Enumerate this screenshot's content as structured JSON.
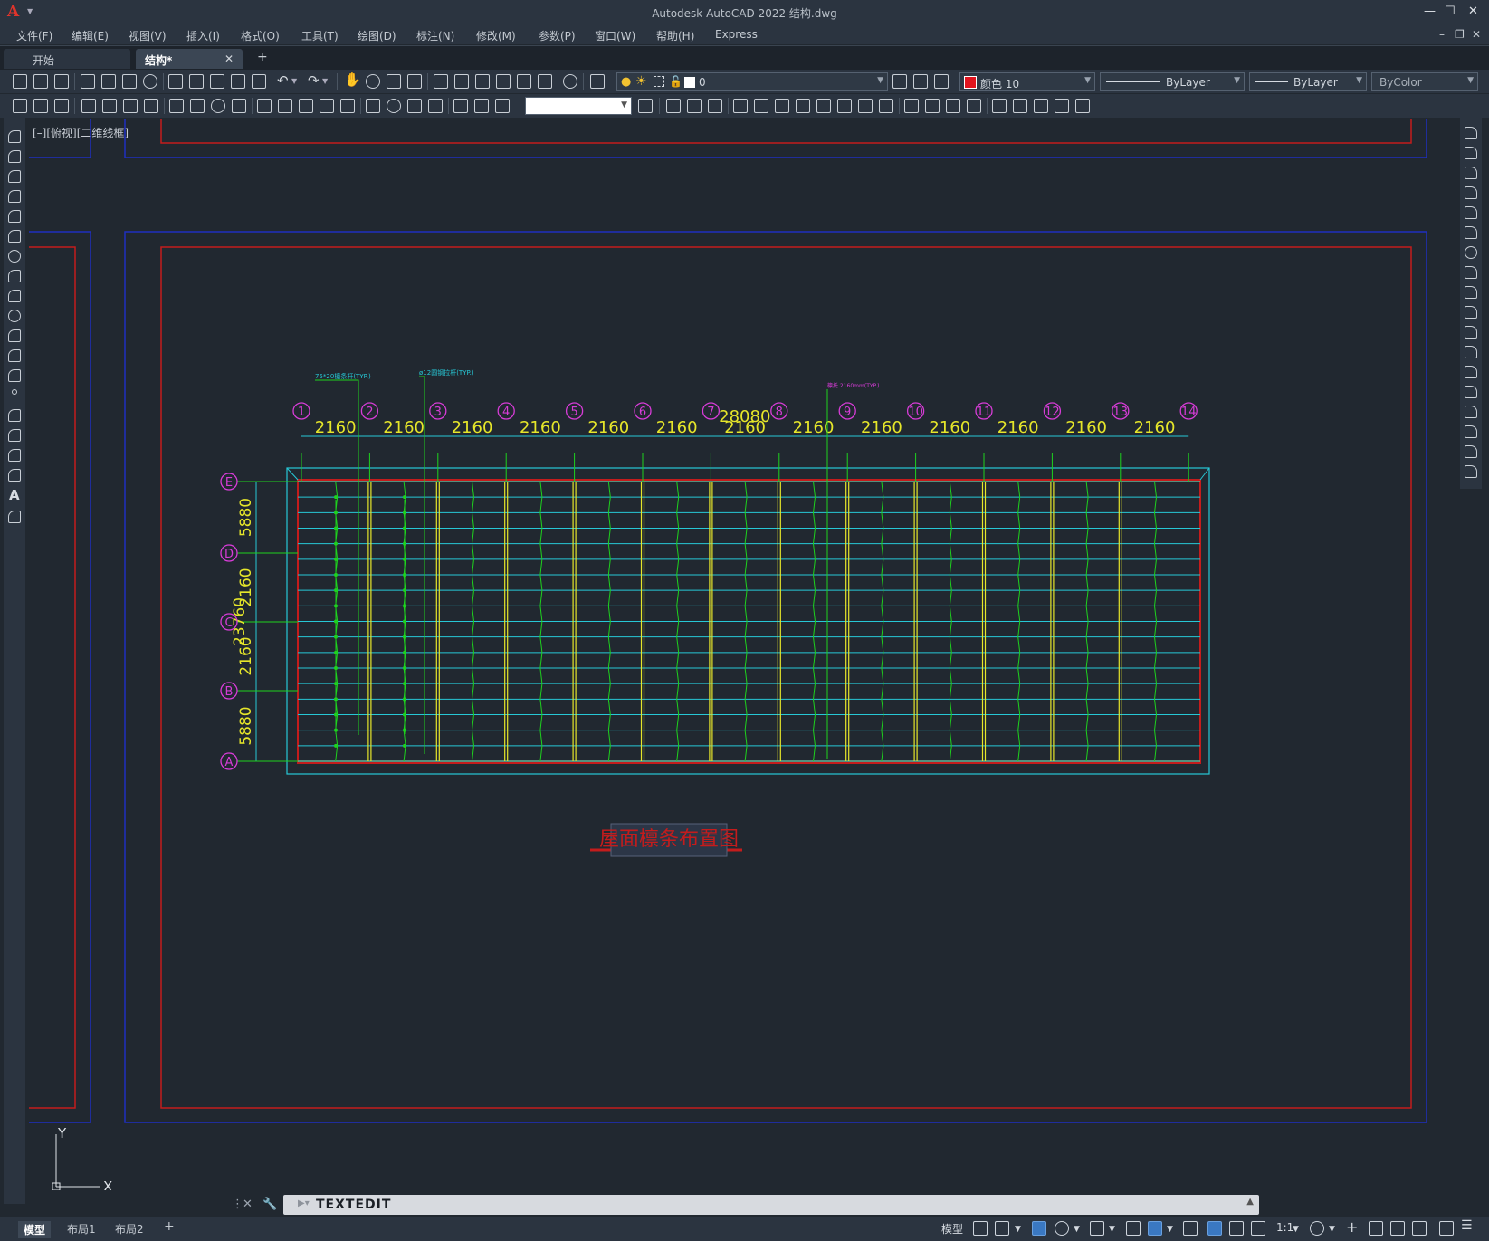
{
  "app": {
    "title": "Autodesk AutoCAD 2022    结构.dwg",
    "logo": "A",
    "window_controls": [
      "—",
      "☐",
      "✕"
    ],
    "doc_controls": [
      "–",
      "❐",
      "✕"
    ]
  },
  "menu": [
    "文件(F)",
    "编辑(E)",
    "视图(V)",
    "插入(I)",
    "格式(O)",
    "工具(T)",
    "绘图(D)",
    "标注(N)",
    "修改(M)",
    "参数(P)",
    "窗口(W)",
    "帮助(H)",
    "Express"
  ],
  "tabs": {
    "items": [
      {
        "label": "开始",
        "active": false
      },
      {
        "label": "结构*",
        "active": true
      }
    ],
    "close": "✕",
    "add": "+"
  },
  "properties": {
    "layer": "0",
    "color": "颜色 10",
    "color_swatch": "#e0141e",
    "linetype": "ByLayer",
    "lineweight": "ByLayer",
    "plotstyle": "ByColor",
    "style_combo": ""
  },
  "viewport": {
    "label": "[–][俯视][二维线框]"
  },
  "drawing": {
    "grid_columns": [
      "1",
      "2",
      "3",
      "4",
      "5",
      "6",
      "7",
      "8",
      "9",
      "10",
      "11",
      "12",
      "13",
      "14"
    ],
    "grid_rows": [
      "E",
      "D",
      "C",
      "B",
      "A"
    ],
    "column_spacing": "2160",
    "total_width": "28080",
    "row_dims": [
      "5880",
      "2160",
      "2160",
      "5880"
    ],
    "row_total": "23760",
    "notes": [
      "75*20檩条杆(TYP.)",
      "ø12圆钢拉杆(TYP.)",
      "檩托 2160mm(TYP.)"
    ],
    "plan_title": "屋面檩条布置图",
    "colors": {
      "frame_blue": "#1f2fbf",
      "frame_red": "#c41c1c",
      "dim_yellow": "#e6e62a",
      "bubble_magenta": "#d73cd7",
      "green": "#1ed21e",
      "cyan": "#27c8d6"
    }
  },
  "ucs": {
    "x": "X",
    "y": "Y"
  },
  "command": {
    "text": "TEXTEDIT"
  },
  "layouts": [
    {
      "label": "模型",
      "active": true
    },
    {
      "label": "布局1",
      "active": false
    },
    {
      "label": "布局2",
      "active": false
    }
  ],
  "layout_add": "+",
  "status": {
    "model": "模型",
    "scale": "1:1"
  }
}
